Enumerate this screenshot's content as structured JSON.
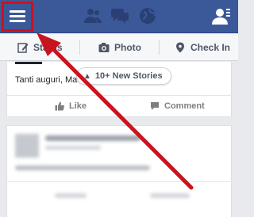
{
  "topbar": {
    "icons": [
      "menu-icon",
      "friends-icon",
      "messages-icon",
      "globe-icon",
      "profile-icon"
    ]
  },
  "composer": {
    "status_label": "Status",
    "photo_label": "Photo",
    "checkin_label": "Check In"
  },
  "feed": {
    "post1_text": "Tanti auguri, Ma",
    "new_stories_label": "10+ New Stories",
    "like_label": "Like",
    "comment_label": "Comment"
  },
  "colors": {
    "brand": "#3b5998",
    "highlight": "#d0101b"
  }
}
